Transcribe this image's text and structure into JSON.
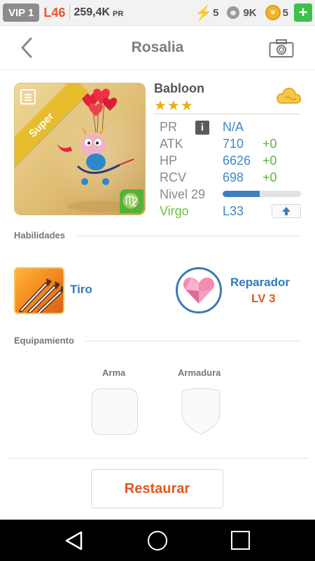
{
  "status_bar": {
    "vip": "VIP 1",
    "level": "L46",
    "power": "259,4K",
    "power_unit": "PR",
    "energy": "5",
    "paws": "9K",
    "coins": "5"
  },
  "header": {
    "title": "Rosalia"
  },
  "hero": {
    "name": "Babloon",
    "stars": "★★★",
    "card_ribbon": "Super",
    "stats": {
      "pr_label": "PR",
      "pr_value": "N/A",
      "atk_label": "ATK",
      "atk_value": "710",
      "atk_bonus": "+0",
      "hp_label": "HP",
      "hp_value": "6626",
      "hp_bonus": "+0",
      "rcv_label": "RCV",
      "rcv_value": "698",
      "rcv_bonus": "+0",
      "level_label": "Nivel 29",
      "level_progress": 0.47,
      "sign_label": "Virgo",
      "sign_level": "L33"
    }
  },
  "skills": {
    "section_title": "Habilidades",
    "active": {
      "name": "Tiro"
    },
    "passive": {
      "name": "Reparador",
      "level": "LV 3"
    }
  },
  "equipment": {
    "section_title": "Equipamiento",
    "weapon_label": "Arma",
    "armor_label": "Armadura"
  },
  "actions": {
    "restore_label": "Restaurar"
  },
  "colors": {
    "accent_blue": "#2f79c0",
    "accent_orange": "#e1571f",
    "bonus_green": "#61b23b"
  }
}
